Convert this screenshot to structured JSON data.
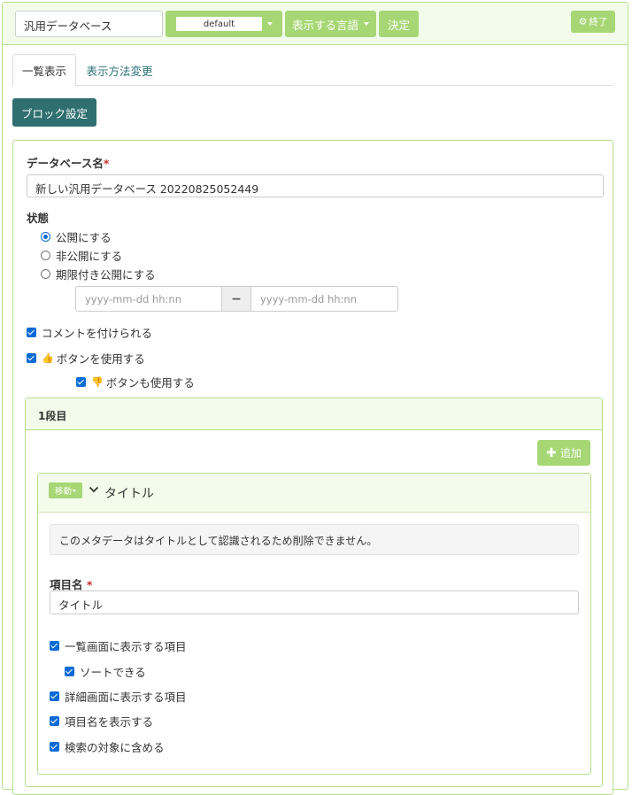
{
  "toolbar": {
    "plugin_name": "汎用データベース",
    "frame_select": "default",
    "language_label": "表示する言語",
    "decide_label": "決定",
    "end_label": "終了",
    "end_icon": "gear-icon"
  },
  "tabs": [
    {
      "label": "一覧表示",
      "active": true
    },
    {
      "label": "表示方法変更",
      "active": false
    }
  ],
  "block_settings_label": "ブロック設定",
  "form": {
    "db_name_label": "データベース名",
    "required_mark": "*",
    "db_name_value": "新しい汎用データベース 20220825052449",
    "status_label": "状態",
    "status_options": [
      {
        "label": "公開にする",
        "checked": true
      },
      {
        "label": "非公開にする",
        "checked": false
      },
      {
        "label": "期限付き公開にする",
        "checked": false
      }
    ],
    "date_from_placeholder": "yyyy-mm-dd hh:nn",
    "date_separator": "−",
    "date_to_placeholder": "yyyy-mm-dd hh:nn",
    "comment_label": "コメントを付けられる",
    "like_label": "ボタンを使用する",
    "like_icon": "thumbs-up-icon",
    "unlike_label": "ボタンも使用する",
    "unlike_icon": "thumbs-down-icon"
  },
  "row_panel": {
    "title": "1段目",
    "add_label": "追加",
    "add_icon": "plus-icon"
  },
  "item_panel": {
    "move_label": "移動",
    "chevron_icon": "chevron-down-icon",
    "title": "タイトル",
    "notice": "このメタデータはタイトルとして認識されるため削除できません。",
    "item_name_label": "項目名",
    "item_name_value": "タイトル",
    "options": [
      {
        "label": "一覧画面に表示する項目",
        "checked": true
      },
      {
        "label": "ソートできる",
        "checked": true
      },
      {
        "label": "詳細画面に表示する項目",
        "checked": true
      },
      {
        "label": "項目名を表示する",
        "checked": true
      },
      {
        "label": "検索の対象に含める",
        "checked": true
      }
    ]
  },
  "colors": {
    "green": "#a6d774",
    "teal": "#2f6f70",
    "panel_border": "#b5df8e",
    "panel_head": "#f3fbea",
    "check_blue": "#0b6bd6"
  }
}
